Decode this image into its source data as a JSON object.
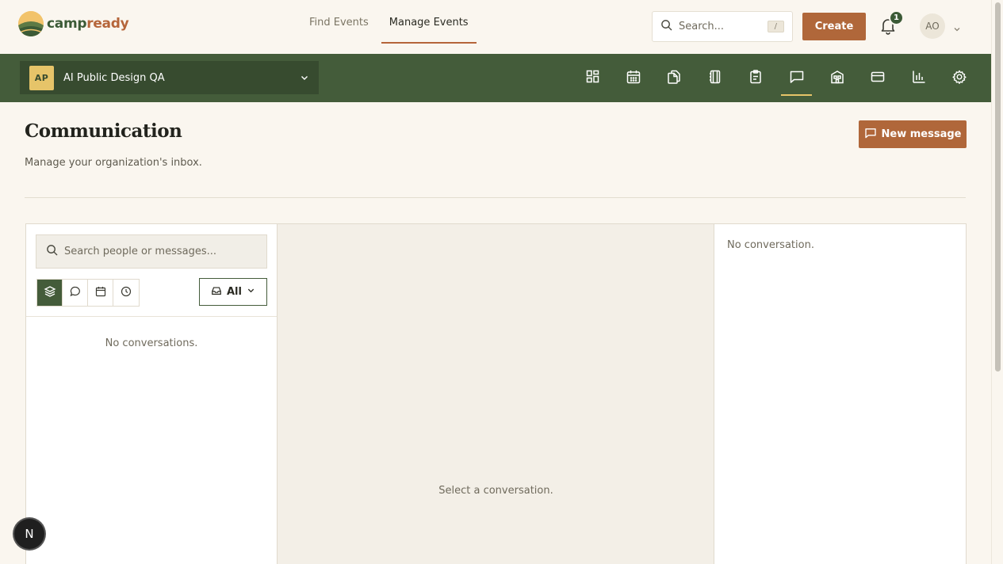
{
  "brand": {
    "name_part1": "camp",
    "name_part2": "ready"
  },
  "nav": {
    "items": [
      {
        "label": "Find Events"
      },
      {
        "label": "Manage Events"
      }
    ]
  },
  "search": {
    "placeholder": "Search...",
    "shortcut": "/"
  },
  "header": {
    "create_label": "Create",
    "notifications_count": "1",
    "avatar_initials": "AO"
  },
  "org": {
    "initials": "AP",
    "name": "AI Public Design QA"
  },
  "tools": {
    "items": [
      {
        "icon": "dashboard-icon"
      },
      {
        "icon": "calendar-icon"
      },
      {
        "icon": "pages-icon"
      },
      {
        "icon": "notebook-icon"
      },
      {
        "icon": "clipboard-icon"
      },
      {
        "icon": "message-icon",
        "active": true
      },
      {
        "icon": "building-icon"
      },
      {
        "icon": "card-icon"
      },
      {
        "icon": "chart-icon"
      },
      {
        "icon": "settings-icon"
      }
    ]
  },
  "page": {
    "title": "Communication",
    "subtitle": "Manage your organization's inbox.",
    "new_message_label": "New message"
  },
  "inbox": {
    "search_placeholder": "Search people or messages...",
    "filter_label": "All",
    "empty_list": "No conversations.",
    "empty_thread": "Select a conversation.",
    "empty_detail": "No conversation."
  },
  "floating": {
    "badge": "N"
  },
  "colors": {
    "accent": "#b0673a",
    "brand_green": "#445c3a",
    "gold": "#e6c469",
    "background": "#faf6ef"
  }
}
